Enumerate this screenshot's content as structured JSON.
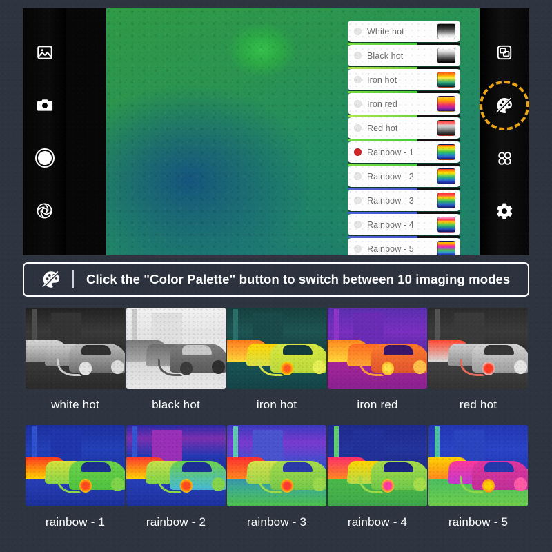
{
  "device": {
    "left_rail": [
      {
        "name": "gallery-icon",
        "label": "Gallery"
      },
      {
        "name": "camera-icon",
        "label": "Photo"
      },
      {
        "name": "shutter-button",
        "label": "Shutter"
      },
      {
        "name": "aperture-icon",
        "label": "Aperture"
      }
    ],
    "right_rail": [
      {
        "name": "picture-in-picture-icon",
        "label": "Picture in picture"
      },
      {
        "name": "color-palette-icon",
        "label": "Color Palette",
        "highlighted": true
      },
      {
        "name": "four-circles-grid-icon",
        "label": "Modes"
      },
      {
        "name": "gear-icon",
        "label": "Settings"
      }
    ]
  },
  "palette_menu": {
    "items": [
      {
        "label": "White hot",
        "selected": false,
        "swatch": "sw-whitehot",
        "accent": "acc-green"
      },
      {
        "label": "Black hot",
        "selected": false,
        "swatch": "sw-blackhot",
        "accent": "acc-green2"
      },
      {
        "label": "Iron hot",
        "selected": false,
        "swatch": "sw-ironhot",
        "accent": "acc-green"
      },
      {
        "label": "Iron red",
        "selected": false,
        "swatch": "sw-ironred",
        "accent": "acc-green2"
      },
      {
        "label": "Red hot",
        "selected": false,
        "swatch": "sw-redhot",
        "accent": "acc-green"
      },
      {
        "label": "Rainbow - 1",
        "selected": true,
        "swatch": "sw-rb1",
        "accent": "acc-green"
      },
      {
        "label": "Rainbow - 2",
        "selected": false,
        "swatch": "sw-rb2",
        "accent": "acc-blue"
      },
      {
        "label": "Rainbow - 3",
        "selected": false,
        "swatch": "sw-rb3",
        "accent": "acc-blue"
      },
      {
        "label": "Rainbow - 4",
        "selected": false,
        "swatch": "sw-rb4",
        "accent": "acc-blue"
      },
      {
        "label": "Rainbow - 5",
        "selected": false,
        "swatch": "sw-rb5",
        "accent": "acc-dark"
      }
    ],
    "selected_label": "Rainbow - 1",
    "selected_color": "#d42626"
  },
  "banner": {
    "icon": "color-palette-icon",
    "text": "Click the \"Color Palette\" button to switch between 10 imaging modes"
  },
  "thumbnails": {
    "row1": [
      {
        "caption": "white hot"
      },
      {
        "caption": "black hot"
      },
      {
        "caption": "iron hot"
      },
      {
        "caption": "iron red"
      },
      {
        "caption": "red hot"
      }
    ],
    "row2": [
      {
        "caption": "rainbow - 1"
      },
      {
        "caption": "rainbow - 2"
      },
      {
        "caption": "rainbow - 3"
      },
      {
        "caption": "rainbow - 4"
      },
      {
        "caption": "rainbow - 5"
      }
    ]
  },
  "colors": {
    "page_background": "#2e3440",
    "highlight_ring": "#e8a317",
    "banner_border": "#ffffff",
    "selected_radio": "#d42626",
    "menu_row_background": "#fdfdfd",
    "menu_label": "#6b6b6b"
  }
}
